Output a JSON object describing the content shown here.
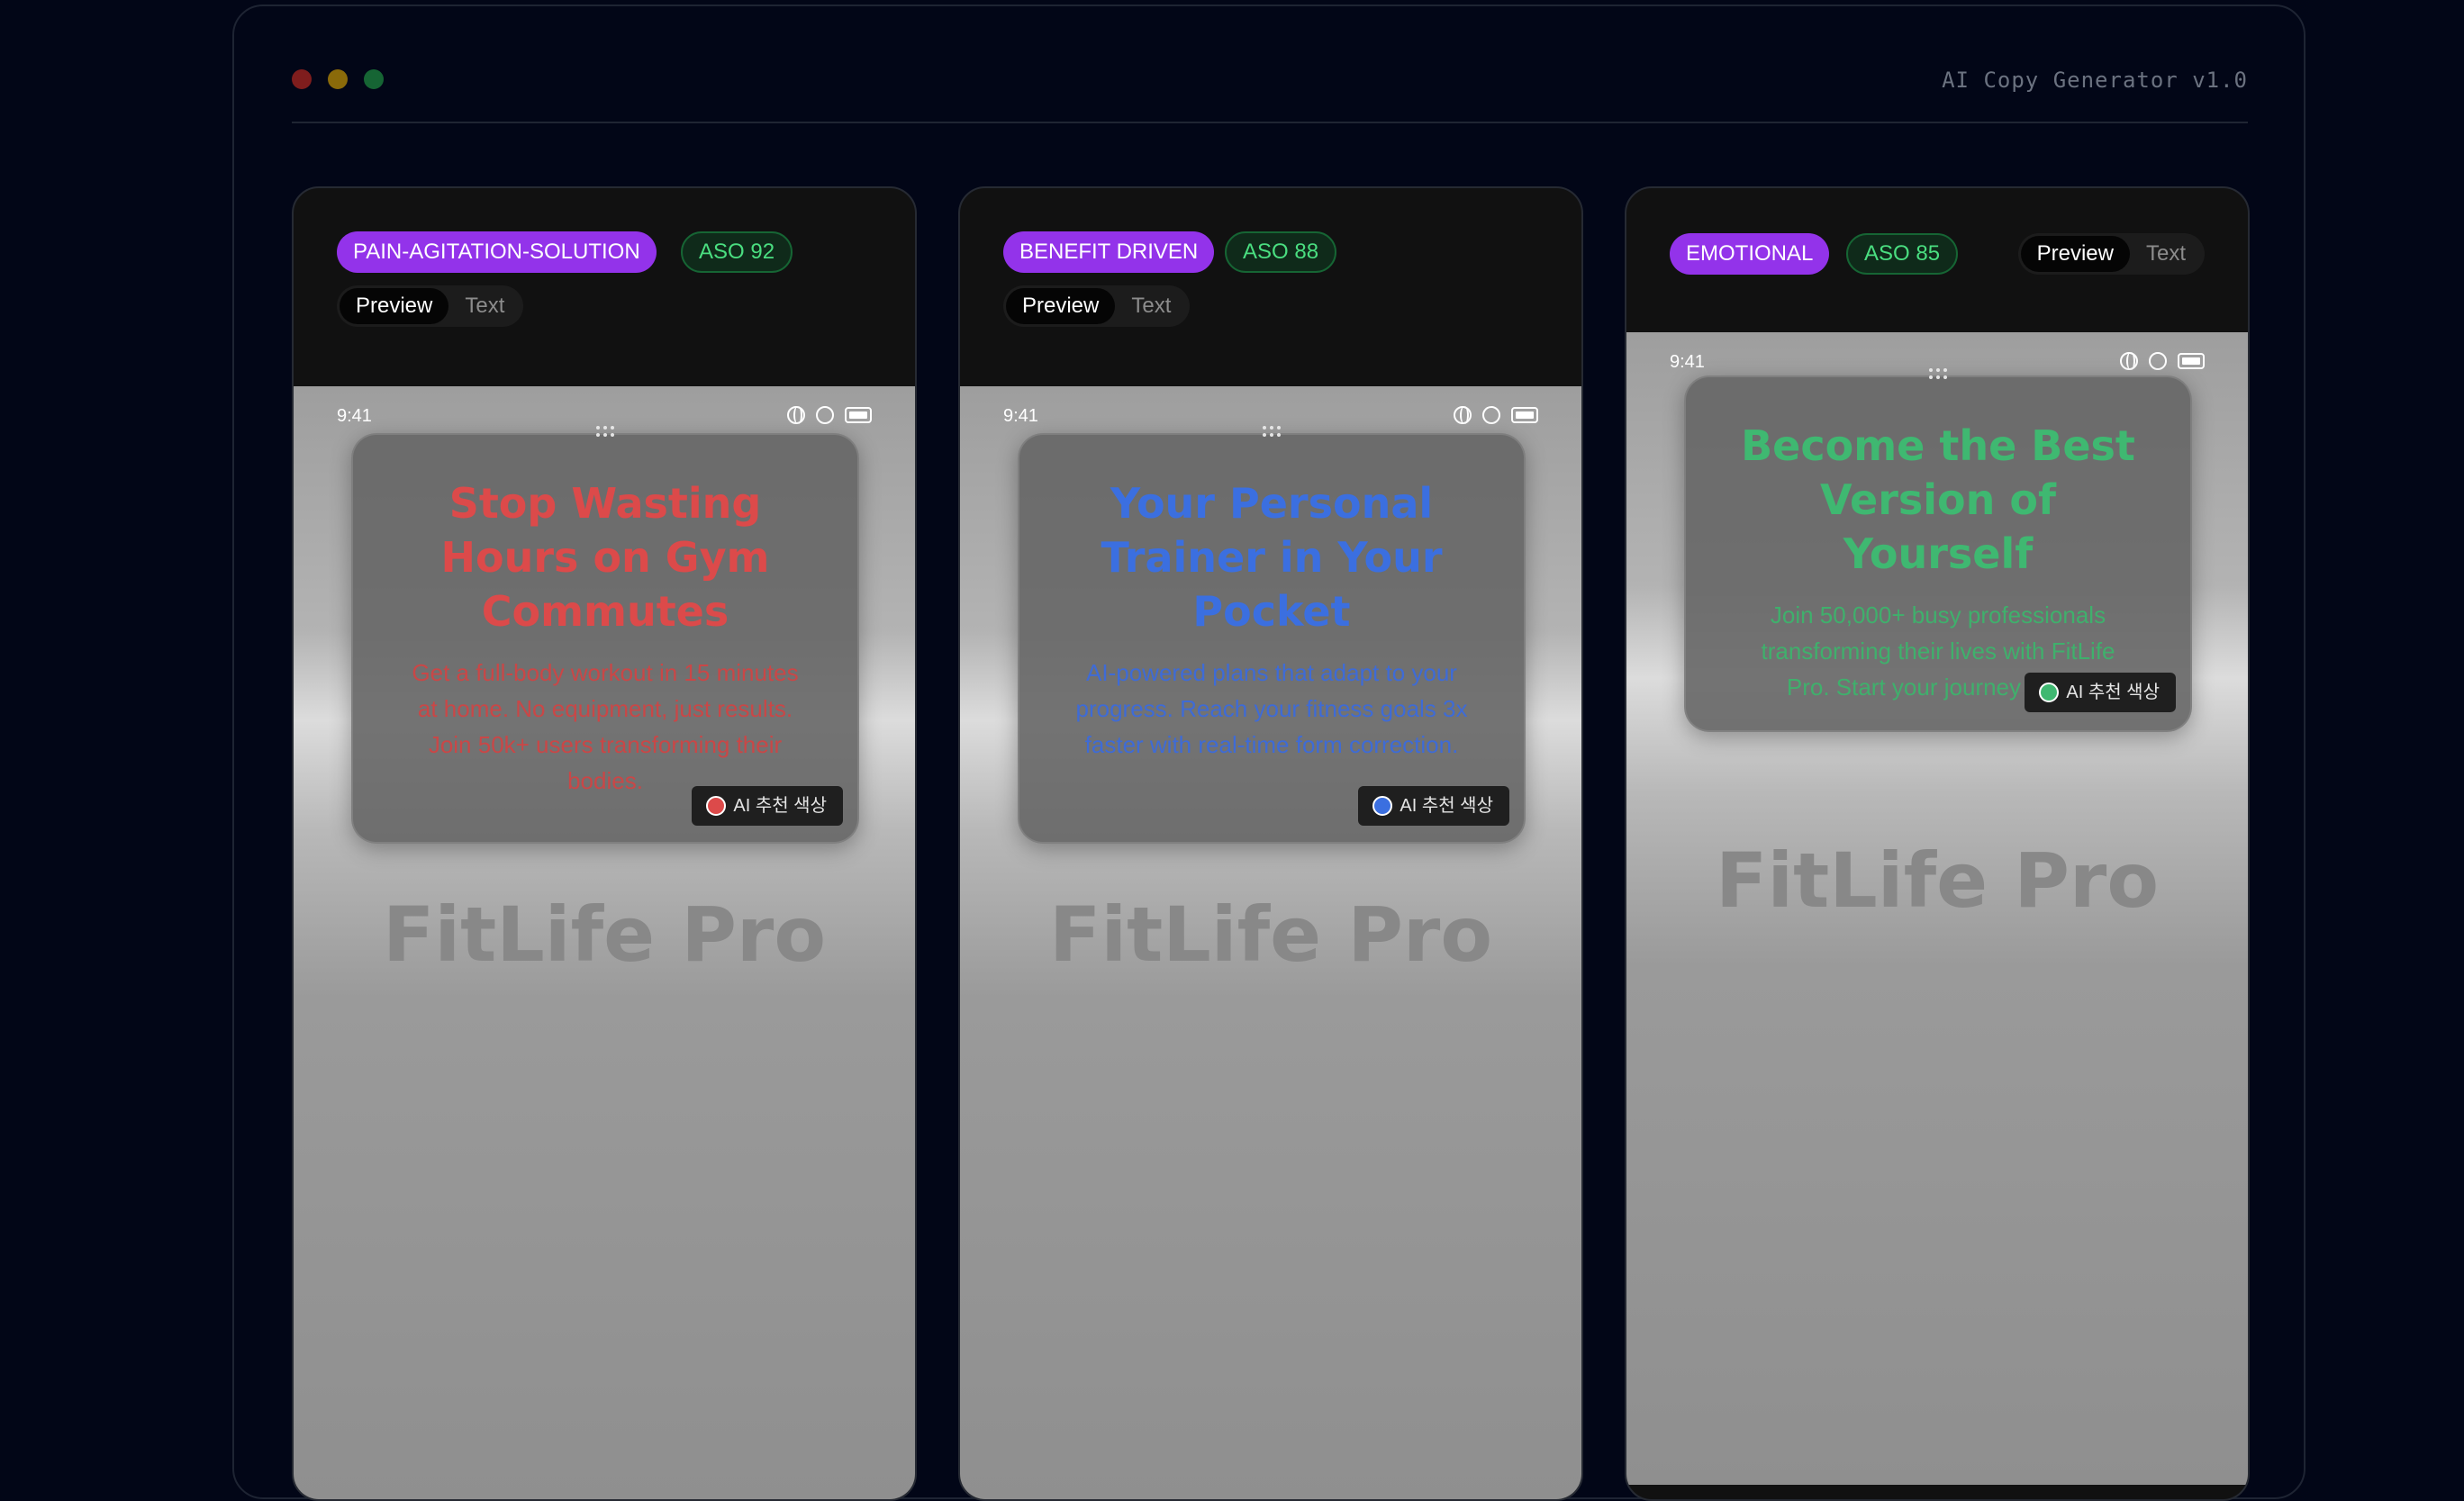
{
  "app": {
    "title": "AI Copy Generator v1.0"
  },
  "cards": [
    {
      "strategy": "PAIN-AGITATION-SOLUTION",
      "aso": "ASO 92",
      "view_toggle": {
        "preview": "Preview",
        "text": "Text",
        "active": "Preview"
      },
      "phone": {
        "time": "9:41",
        "headline": "Stop Wasting Hours on Gym Commutes",
        "subtext": "Get a full-body workout in 15 minutes at home. No equipment, just results. Join 50k+ users transforming their bodies.",
        "accent_color": "#dc4a4a",
        "ai_badge": "AI 추천 색상",
        "app_name": "FitLife Pro"
      }
    },
    {
      "strategy": "BENEFIT DRIVEN",
      "aso": "ASO 88",
      "view_toggle": {
        "preview": "Preview",
        "text": "Text",
        "active": "Preview"
      },
      "phone": {
        "time": "9:41",
        "headline": "Your Personal Trainer in Your Pocket",
        "subtext": "AI-powered plans that adapt to your progress. Reach your fitness goals 3x faster with real-time form correction.",
        "accent_color": "#3b6fe0",
        "ai_badge": "AI 추천 색상",
        "app_name": "FitLife Pro"
      }
    },
    {
      "strategy": "EMOTIONAL",
      "aso": "ASO 85",
      "view_toggle": {
        "preview": "Preview",
        "text": "Text",
        "active": "Preview"
      },
      "phone": {
        "time": "9:41",
        "headline": "Become the Best Version of Yourself",
        "subtext": "Join 50,000+ busy professionals transforming their lives with FitLife Pro. Start your journey today.",
        "accent_color": "#3fb871",
        "ai_badge": "AI 추천 색상",
        "app_name": "FitLife Pro"
      }
    }
  ],
  "colors": {
    "background": "#020617",
    "strategy_pill": "#9333ea",
    "aso_text": "#4ade80"
  }
}
